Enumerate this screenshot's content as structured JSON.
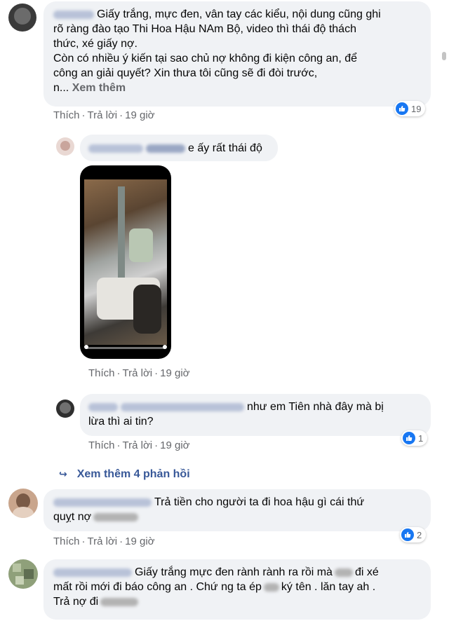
{
  "colors": {
    "bubble": "#f0f2f5",
    "meta_text": "#65676b",
    "link_blue": "#385898",
    "like_blue": "#1877f2"
  },
  "comments": [
    {
      "text_lines": [
        "Giấy trắng, mực đen, vân tay các kiểu, nội dung cũng ghi",
        "rõ ràng đào tạo Thi Hoa Hậu NAm Bộ, video thì thái độ thách",
        "thức, xé giấy nợ.",
        "Còn có nhiều ý kiến tại sao chủ nợ không đi kiện công an, để",
        "công an giải quyết? Xin thưa tôi cũng sẽ đi đòi trước,"
      ],
      "last_line_prefix": "n...",
      "see_more": "Xem thêm",
      "like": "Thích",
      "reply": "Trả lời",
      "time": "19 giờ",
      "reaction_count": "19"
    },
    {
      "text": "e ấy rất thái độ",
      "like": "Thích",
      "reply": "Trả lời",
      "time": "19 giờ",
      "video_icon": "pause-icon"
    },
    {
      "text_lines": [
        "như em Tiên nhà đây mà bị",
        "lừa thì ai tin?"
      ],
      "like": "Thích",
      "reply": "Trả lời",
      "time": "19 giờ",
      "reaction_count": "1"
    },
    {
      "text_lines": [
        "Trả tiền cho người ta đi hoa hậu gì cái thứ",
        "quỵt nợ"
      ],
      "like": "Thích",
      "reply": "Trả lời",
      "time": "19 giờ",
      "reaction_count": "2"
    },
    {
      "text_lines": [
        "Giấy trắng mực đen rành rành ra rồi mà",
        "đi xé",
        "mất rồi mới đi báo công an . Chứ ng ta ép",
        "ký tên . lăn tay ah .",
        "Trả nợ đi"
      ]
    }
  ],
  "more_replies": "Xem thêm 4 phản hồi"
}
